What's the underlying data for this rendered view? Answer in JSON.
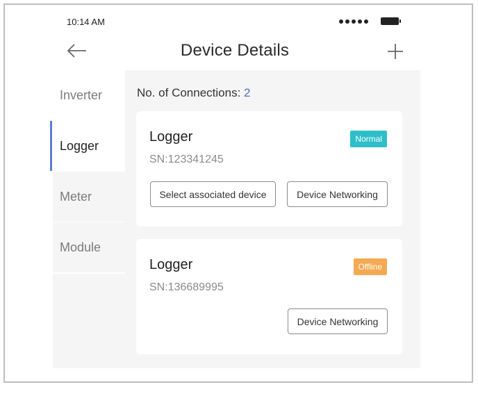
{
  "status": {
    "time": "10:14 AM"
  },
  "header": {
    "title": "Device Details"
  },
  "sidebar": {
    "items": [
      {
        "label": "Inverter"
      },
      {
        "label": "Logger"
      },
      {
        "label": "Meter"
      },
      {
        "label": "Module"
      }
    ],
    "active": "Logger"
  },
  "main": {
    "connections_label": "No. of Connections:",
    "connections_count": "2",
    "devices": [
      {
        "name": "Logger",
        "sn": "SN:123341245",
        "status": "Normal",
        "status_color": "#2dbec8",
        "buttons": [
          "Select associated device",
          "Device Networking"
        ]
      },
      {
        "name": "Logger",
        "sn": "SN:136689995",
        "status": "Offline",
        "status_color": "#f4a952",
        "buttons": [
          "Device Networking"
        ]
      }
    ]
  },
  "colors": {
    "accent": "#5b7fcf",
    "count": "#4a6fc4"
  },
  "icons": {
    "back": "arrow-left-icon",
    "add": "plus-icon"
  }
}
